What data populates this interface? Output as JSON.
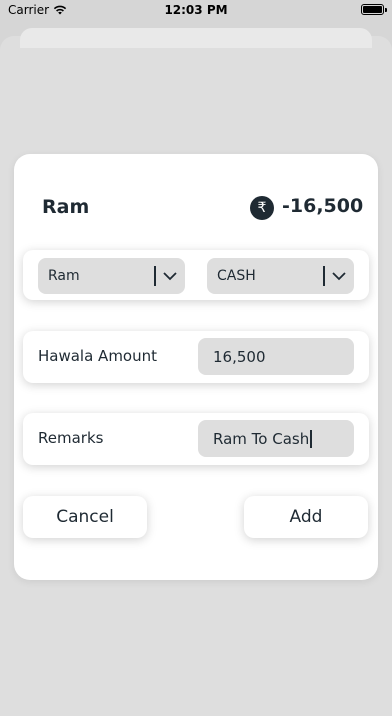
{
  "status_bar": {
    "carrier": "Carrier",
    "time": "12:03 PM"
  },
  "header": {
    "name": "Ram",
    "currency_symbol": "₹",
    "amount": "-16,500"
  },
  "dropdowns": {
    "from_value": "Ram",
    "to_value": "CASH"
  },
  "hawala": {
    "label": "Hawala Amount",
    "value": "16,500"
  },
  "remarks": {
    "label": "Remarks",
    "value": "Ram To Cash"
  },
  "buttons": {
    "cancel": "Cancel",
    "add": "Add"
  },
  "colors": {
    "primary": "#1f2a33",
    "field_bg": "#dedede",
    "backdrop": "#d6d6d6"
  },
  "icons": [
    "wifi-icon",
    "battery-icon",
    "rupee-icon",
    "chevron-down-icon"
  ]
}
